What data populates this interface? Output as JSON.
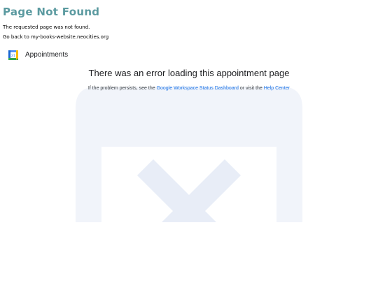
{
  "not_found": {
    "title": "Page Not Found",
    "message": "The requested page was not found.",
    "back_prefix": "Go back to ",
    "back_link": "my-books-website.neocities.org"
  },
  "app": {
    "icon": "calendar-icon",
    "icon_day": "31",
    "title": "Appointments"
  },
  "error": {
    "heading": "There was an error loading this appointment page",
    "help_prefix": "If the problem persists, see the ",
    "status_link": "Google Workspace Status Dashboard",
    "help_middle": " or visit the ",
    "help_link": "Help Center"
  },
  "colors": {
    "not_found_title": "#5b9aa0",
    "link_blue": "#1a73e8",
    "graphic": "#f1f4fa"
  }
}
